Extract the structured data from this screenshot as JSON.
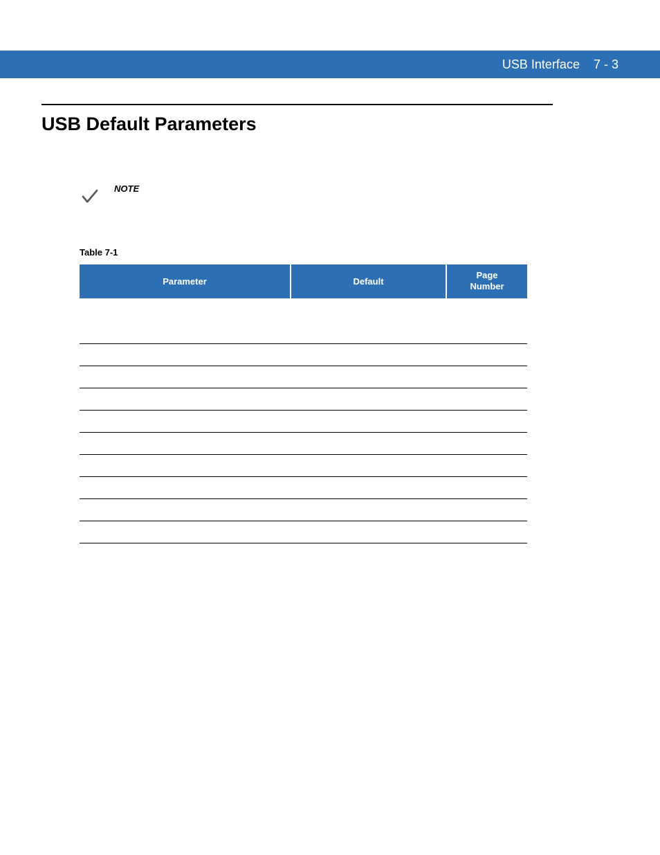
{
  "header": {
    "title": "USB Interface",
    "page_ref": "7 - 3"
  },
  "section_title": "USB Default Parameters",
  "note": {
    "label": "NOTE"
  },
  "table": {
    "caption": "Table 7-1",
    "headers": {
      "parameter": "Parameter",
      "default": "Default",
      "page_number_line1": "Page",
      "page_number_line2": "Number"
    },
    "section_row": {},
    "rows": [
      {
        "parameter": "",
        "default": "",
        "page": ""
      },
      {
        "parameter": "",
        "default": "",
        "page": ""
      },
      {
        "parameter": "",
        "default": "",
        "page": ""
      },
      {
        "parameter": "",
        "default": "",
        "page": ""
      },
      {
        "parameter": "",
        "default": "",
        "page": ""
      },
      {
        "parameter": "",
        "default": "",
        "page": ""
      },
      {
        "parameter": "",
        "default": "",
        "page": ""
      },
      {
        "parameter": "",
        "default": "",
        "page": ""
      },
      {
        "parameter": "",
        "default": "",
        "page": ""
      },
      {
        "parameter": "",
        "default": "",
        "page": ""
      }
    ]
  }
}
